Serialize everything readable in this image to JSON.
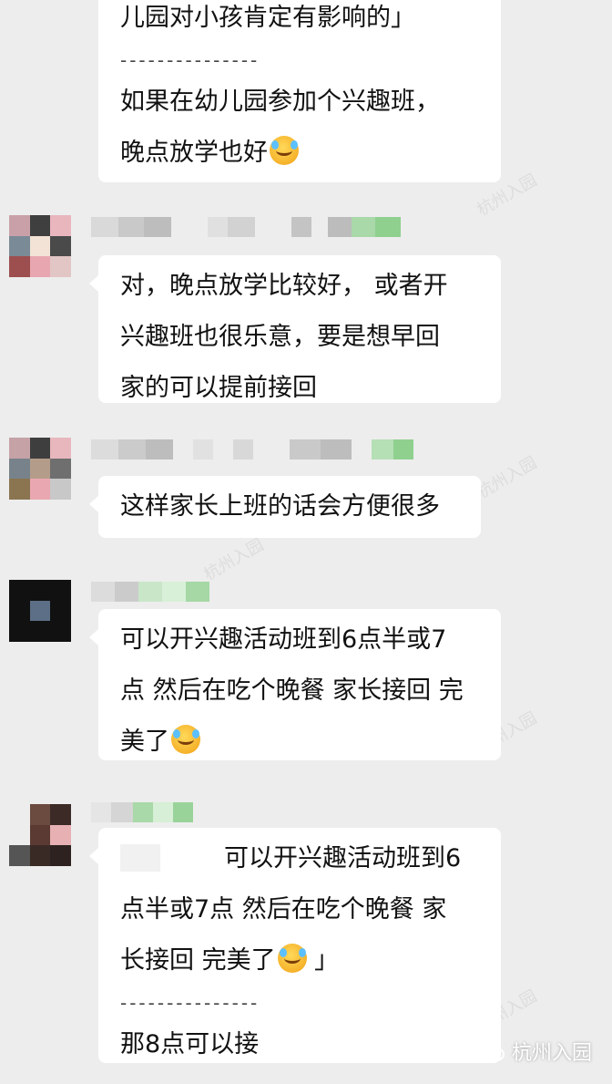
{
  "messages": [
    {
      "lines": [
        "儿园对小孩肯定有影响的」"
      ],
      "divider": "---------------",
      "reply_lines": [
        "如果在幼儿园参加个兴趣班，",
        "晚点放学也好"
      ],
      "emoji": "facepalm-laugh-emoji"
    },
    {
      "lines": [
        "对，晚点放学比较好， 或者开",
        "兴趣班也很乐意，要是想早回",
        "家的可以提前接回"
      ]
    },
    {
      "lines": [
        "这样家长上班的话会方便很多"
      ]
    },
    {
      "lines": [
        "可以开兴趣活动班到6点半或7",
        "点 然后在吃个晚餐 家长接回 完",
        "美了"
      ],
      "emoji": "facepalm-laugh-emoji"
    },
    {
      "quote_lines": [
        "可以开兴趣活动班到6",
        "点半或7点 然后在吃个晚餐 家",
        "长接回 完美了"
      ],
      "quote_close": " 」",
      "divider": "---------------",
      "reply_lines": [
        "那8点可以接"
      ]
    }
  ],
  "footer": {
    "account": "杭州入园",
    "icon": "wechat-icon"
  },
  "colors": {
    "background": "#ededed",
    "bubble": "#ffffff",
    "name_green": "#7ed07e"
  }
}
